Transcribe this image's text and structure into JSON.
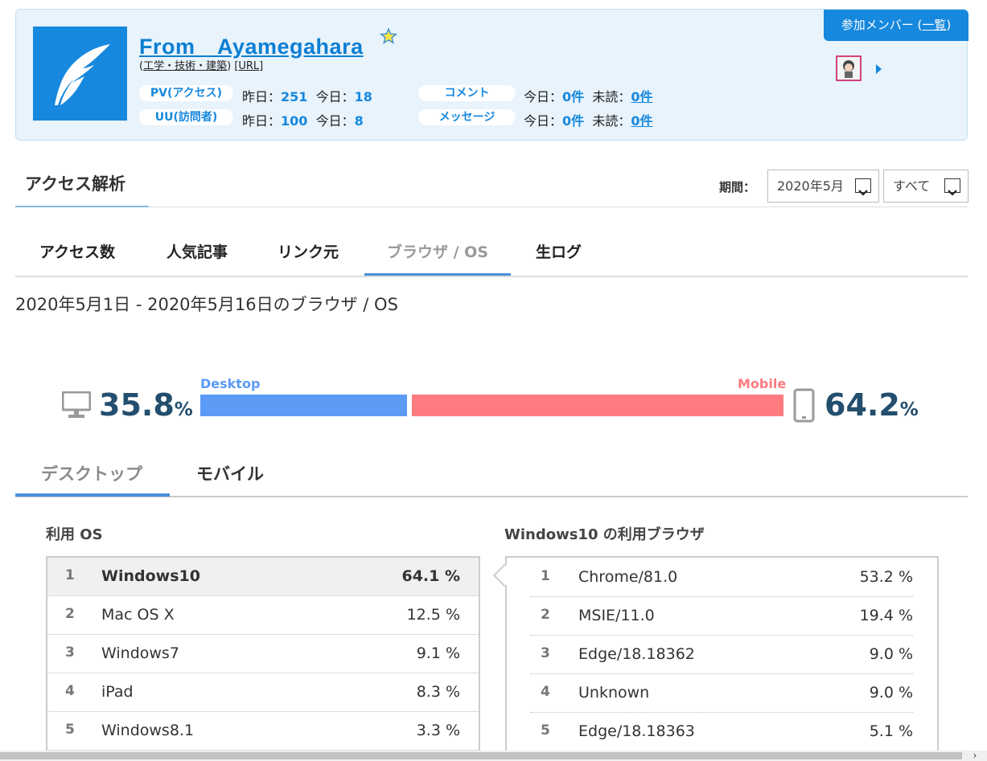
{
  "blog": {
    "title": "From　Ayamegahara",
    "category": "工学・技術・建築",
    "url_link": "[URL]",
    "pv_label": "PV(アクセス)",
    "uu_label": "UU(訪問者)",
    "comment_label": "コメント",
    "message_label": "メッセージ",
    "pv_yesterday": "251",
    "pv_today": "18",
    "uu_yesterday": "100",
    "uu_today": "8",
    "comment_today": "0件",
    "comment_unread": "0件",
    "message_today": "0件",
    "message_unread": "0件",
    "yesterday_label": "昨日：",
    "today_label": "今日：",
    "unread_label": "未読：",
    "member_button": "参加メンバー (",
    "member_list": "一覧",
    "member_close": ")"
  },
  "section": {
    "title": "アクセス解析",
    "period_label": "期間：",
    "period_value": "2020年5月",
    "filter_value": "すべて"
  },
  "tabs": [
    "アクセス数",
    "人気記事",
    "リンク元",
    "ブラウザ / OS",
    "生ログ"
  ],
  "range_title": "2020年5月1日 - 2020年5月16日のブラウザ / OS",
  "split": {
    "desktop_label": "Desktop",
    "mobile_label": "Mobile",
    "desktop_pct": "35.8",
    "mobile_pct": "64.2",
    "unit": "%",
    "desktop_share": 0.358,
    "desktop_color": "#5b9bf5",
    "mobile_color": "#ff7b80"
  },
  "device_tabs": [
    "デスクトップ",
    "モバイル"
  ],
  "os_table": {
    "heading": "利用 OS",
    "rows": [
      {
        "rank": "1",
        "name": "Windows10",
        "pct": "64.1 %"
      },
      {
        "rank": "2",
        "name": "Mac OS X",
        "pct": "12.5 %"
      },
      {
        "rank": "3",
        "name": "Windows7",
        "pct": "9.1 %"
      },
      {
        "rank": "4",
        "name": "iPad",
        "pct": "8.3 %"
      },
      {
        "rank": "5",
        "name": "Windows8.1",
        "pct": "3.3 %"
      }
    ]
  },
  "browser_table": {
    "heading": "Windows10 の利用ブラウザ",
    "rows": [
      {
        "rank": "1",
        "name": "Chrome/81.0",
        "pct": "53.2 %"
      },
      {
        "rank": "2",
        "name": "MSIE/11.0",
        "pct": "19.4 %"
      },
      {
        "rank": "3",
        "name": "Edge/18.18362",
        "pct": "9.0 %"
      },
      {
        "rank": "4",
        "name": "Unknown",
        "pct": "9.0 %"
      },
      {
        "rank": "5",
        "name": "Edge/18.18363",
        "pct": "5.1 %"
      }
    ]
  }
}
